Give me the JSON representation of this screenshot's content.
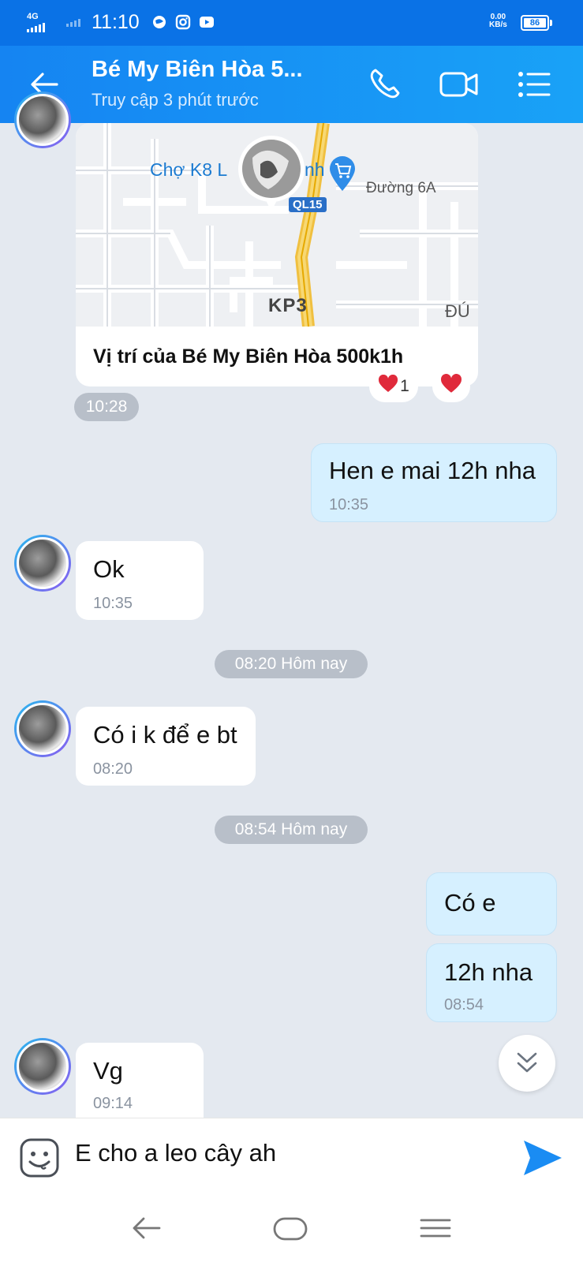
{
  "status_bar": {
    "network": "4G",
    "time": "11:10",
    "speed_value": "0.00",
    "speed_unit": "KB/s",
    "battery": "86"
  },
  "header": {
    "title": "Bé My Biên Hòa 5...",
    "subtitle": "Truy cập 3 phút trước",
    "icons": [
      "back-arrow-icon",
      "phone-icon",
      "video-call-icon",
      "menu-list-icon"
    ]
  },
  "map_card": {
    "labels": {
      "market": "Chợ K8 L",
      "market_tail": "nh",
      "road_6a": "Đường 6A",
      "highway": "QL15",
      "kp3": "KP3",
      "edge": "ĐÚ"
    },
    "caption": "Vị trí của Bé My Biên Hòa 500k1h",
    "reaction_count": "1",
    "time": "10:28"
  },
  "messages": [
    {
      "side": "out",
      "text": "Hen e mai 12h nha",
      "time": "10:35"
    },
    {
      "side": "in",
      "text": "Ok",
      "time": "10:35"
    },
    {
      "side": "in",
      "text": "Có i k để e bt",
      "time": "08:20"
    },
    {
      "side": "out",
      "text": "Có e",
      "time": ""
    },
    {
      "side": "out",
      "text": "12h nha",
      "time": "08:54"
    },
    {
      "side": "in",
      "text": "Vg",
      "time": "09:14"
    }
  ],
  "date_separators": [
    "08:20 Hôm nay",
    "08:54 Hôm nay"
  ],
  "composer": {
    "text": "E cho a leo cây ah"
  },
  "colors": {
    "header": "#1584f2",
    "status_bar": "#0a72e6",
    "outgoing_bubble": "#d6f0ff",
    "chat_background": "#e4e9f0",
    "send": "#1a8cf3"
  }
}
